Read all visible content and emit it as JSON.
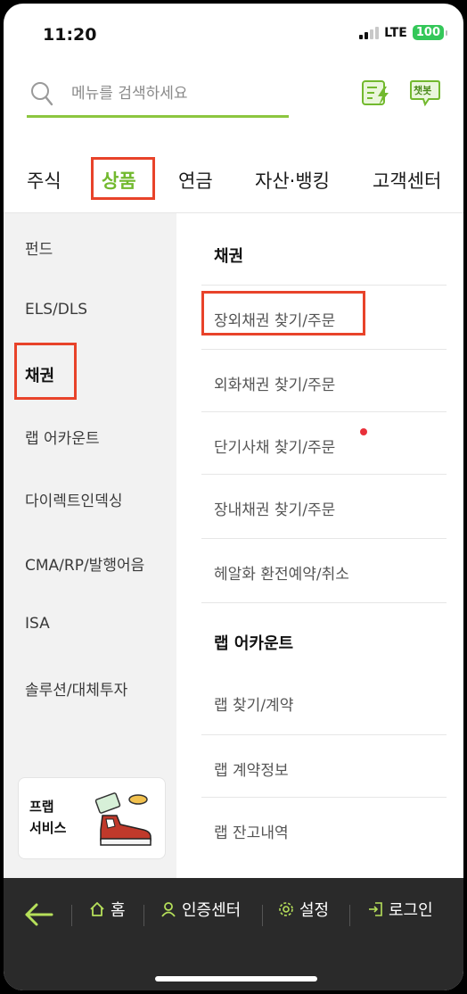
{
  "status": {
    "time": "11:20",
    "network": "LTE",
    "battery": "100"
  },
  "search": {
    "placeholder": "메뉴를 검색하세요"
  },
  "header_icons": {
    "chatbot_label": "챗봇"
  },
  "tabs": [
    {
      "label": "주식"
    },
    {
      "label": "상품"
    },
    {
      "label": "연금"
    },
    {
      "label": "자산·뱅킹"
    },
    {
      "label": "고객센터"
    }
  ],
  "active_tab": "상품",
  "left_menu": [
    {
      "label": "펀드"
    },
    {
      "label": "ELS/DLS"
    },
    {
      "label": "채권"
    },
    {
      "label": "랩 어카운트"
    },
    {
      "label": "다이렉트인덱싱"
    },
    {
      "label": "CMA/RP/발행어음"
    },
    {
      "label": "ISA"
    },
    {
      "label": "솔루션/대체투자"
    }
  ],
  "promo": {
    "line1": "프랩",
    "line2": "서비스"
  },
  "sections": [
    {
      "title": "채권",
      "items": [
        {
          "label": "장외채권 찾기/주문"
        },
        {
          "label": "외화채권 찾기/주문"
        },
        {
          "label": "단기사채 찾기/주문"
        },
        {
          "label": "장내채권 찾기/주문"
        },
        {
          "label": "헤알화 환전예약/취소"
        }
      ]
    },
    {
      "title": "랩 어카운트",
      "items": [
        {
          "label": "랩 찾기/계약"
        },
        {
          "label": "랩 계약정보"
        },
        {
          "label": "랩 잔고내역"
        }
      ]
    }
  ],
  "bottom_nav": [
    {
      "label": "홈"
    },
    {
      "label": "인증센터"
    },
    {
      "label": "설정"
    },
    {
      "label": "로그인"
    }
  ],
  "colors": {
    "accent": "#72b92e",
    "highlight": "#e8432a",
    "bottom_bar": "#2a2a2a",
    "new_dot": "#e8303a"
  }
}
